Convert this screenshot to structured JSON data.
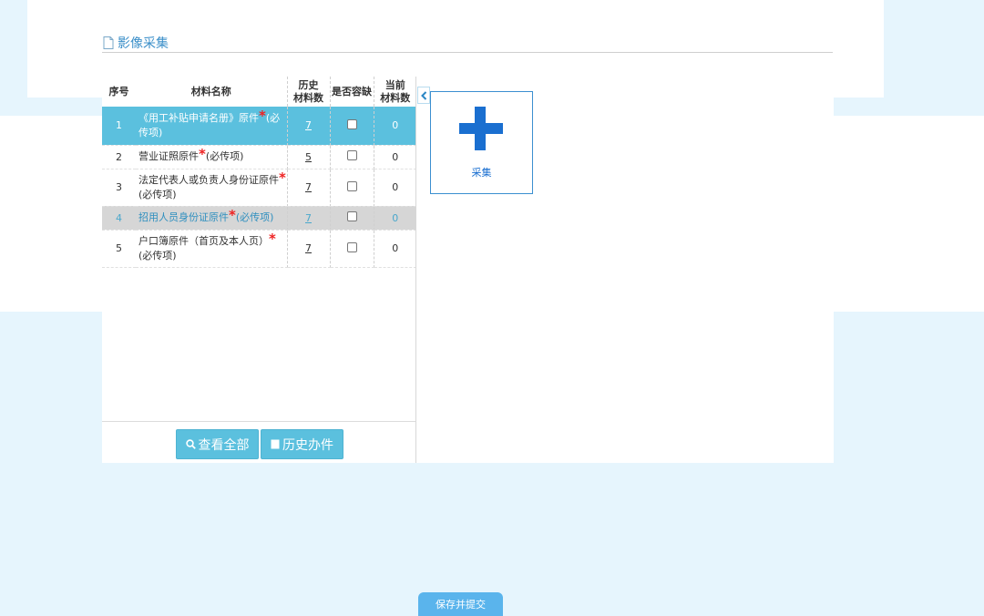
{
  "section": {
    "title": "影像采集",
    "icon": "document-icon"
  },
  "table": {
    "headers": {
      "index": "序号",
      "name": "材料名称",
      "history_1": "历史",
      "history_2": "材料数",
      "fault_tolerant": "是否容缺",
      "current_1": "当前",
      "current_2": "材料数"
    },
    "rows": [
      {
        "index": "1",
        "name": "《用工补贴申请名册》原件",
        "required_star": "*",
        "required_note": "(必传项)",
        "history": "7",
        "fault_tolerant": false,
        "current": "0",
        "state": "selected"
      },
      {
        "index": "2",
        "name": "营业证照原件",
        "required_star": "*",
        "required_note": "(必传项)",
        "history": "5",
        "fault_tolerant": false,
        "current": "0",
        "state": "normal"
      },
      {
        "index": "3",
        "name": "法定代表人或负责人身份证原件",
        "required_star": "*",
        "required_note": "(必传项)",
        "history": "7",
        "fault_tolerant": false,
        "current": "0",
        "state": "normal"
      },
      {
        "index": "4",
        "name": "招用人员身份证原件",
        "required_star": "*",
        "required_note": "(必传项)",
        "history": "7",
        "fault_tolerant": false,
        "current": "0",
        "state": "grey"
      },
      {
        "index": "5",
        "name": "户口簿原件（首页及本人页）",
        "required_star": "*",
        "required_note": "(必传项)",
        "history": "7",
        "fault_tolerant": false,
        "current": "0",
        "state": "normal"
      }
    ]
  },
  "buttons": {
    "view_all": "查看全部",
    "history_cases": "历史办件",
    "capture": "采集",
    "save_submit": "保存并提交"
  },
  "colors": {
    "accent": "#5bc0de",
    "primary_blue": "#1a6fd0",
    "page_bg": "#e6f5fd",
    "required": "#e22222"
  }
}
